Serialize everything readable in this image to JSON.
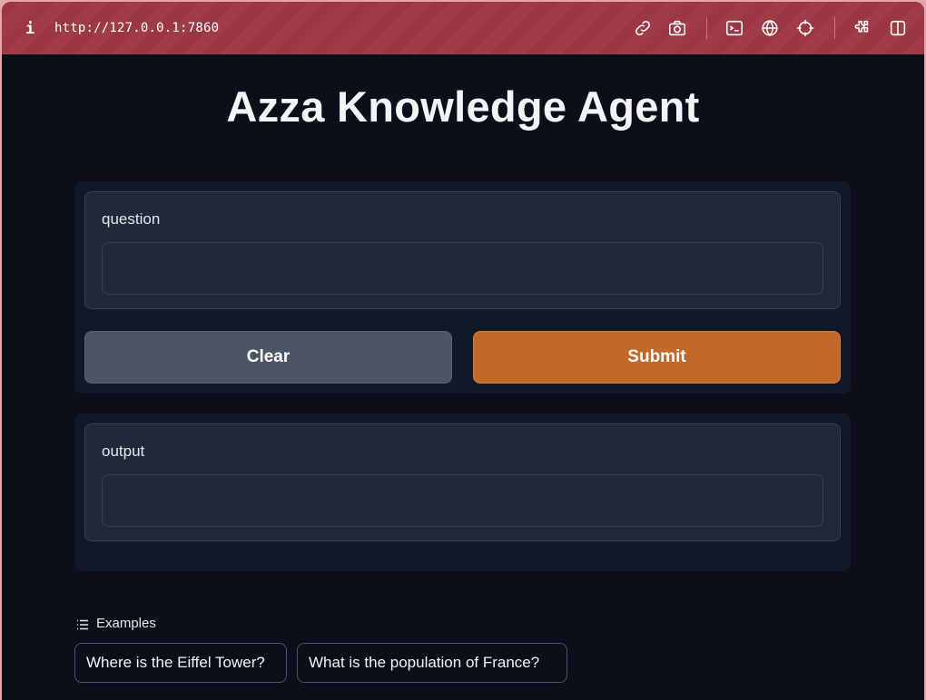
{
  "browser": {
    "info_glyph": "i",
    "url": "http://127.0.0.1:7860",
    "icons": [
      "link-icon",
      "camera-icon",
      "terminal-icon",
      "globe-icon",
      "crosshair-icon",
      "extension-icon",
      "sidebar-icon"
    ]
  },
  "app": {
    "title": "Azza Knowledge Agent",
    "input": {
      "label": "question",
      "value": ""
    },
    "buttons": {
      "clear": "Clear",
      "submit": "Submit"
    },
    "output": {
      "label": "output",
      "value": ""
    },
    "examples": {
      "heading": "Examples",
      "items": [
        "Where is the Eiffel Tower?",
        "What is the population of France?"
      ]
    }
  },
  "colors": {
    "topbar": "#9b3743",
    "background": "#0b0f19",
    "panel": "#111827",
    "submit": "#c2692a",
    "clear": "#4b5563"
  }
}
